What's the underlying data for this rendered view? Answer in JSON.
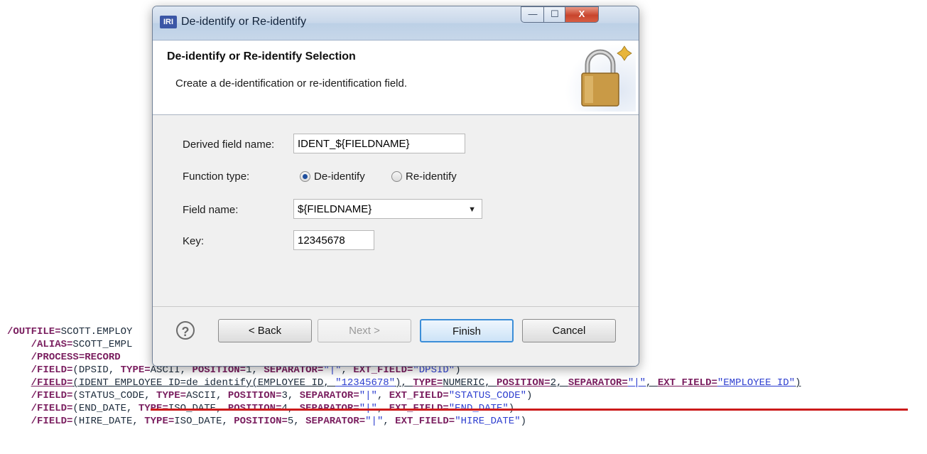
{
  "code_lines": [
    {
      "indent": "",
      "parts": [
        {
          "t": "/OUTFILE=",
          "c": "kw"
        },
        {
          "t": "SCOTT.EMPLOY",
          "c": "sym"
        }
      ]
    },
    {
      "indent": "    ",
      "parts": [
        {
          "t": "/ALIAS=",
          "c": "kw"
        },
        {
          "t": "SCOTT_EMPL",
          "c": "sym"
        }
      ]
    },
    {
      "indent": "    ",
      "parts": [
        {
          "t": "/PROCESS=",
          "c": "kw"
        },
        {
          "t": "RECORD",
          "c": "kw"
        }
      ]
    },
    {
      "indent": "    ",
      "parts": [
        {
          "t": "/FIELD=",
          "c": "kw"
        },
        {
          "t": "(DPSID, ",
          "c": "sym"
        },
        {
          "t": "TYPE=",
          "c": "kw"
        },
        {
          "t": "ASCII, ",
          "c": "sym"
        },
        {
          "t": "POSITION=",
          "c": "kw"
        },
        {
          "t": "1, ",
          "c": "sym"
        },
        {
          "t": "SEPARATOR=",
          "c": "kw"
        },
        {
          "t": "\"|\"",
          "c": "str"
        },
        {
          "t": ", ",
          "c": "sym"
        },
        {
          "t": "EXT_FIELD=",
          "c": "kw"
        },
        {
          "t": "\"DPSID\"",
          "c": "str"
        },
        {
          "t": ")",
          "c": "sym"
        }
      ]
    },
    {
      "indent": "    ",
      "parts": [
        {
          "t": "/FIELD=",
          "c": "kw ul"
        },
        {
          "t": "(IDENT_EMPLOYEE_ID=de_identify(EMPLOYEE_ID, ",
          "c": "sym ul"
        },
        {
          "t": "\"12345678\"",
          "c": "str ul"
        },
        {
          "t": "), ",
          "c": "sym ul"
        },
        {
          "t": "TYPE=",
          "c": "kw ul"
        },
        {
          "t": "NUMERIC, ",
          "c": "sym ul"
        },
        {
          "t": "POSITION=",
          "c": "kw ul"
        },
        {
          "t": "2, ",
          "c": "sym ul"
        },
        {
          "t": "SEPARATOR=",
          "c": "kw ul"
        },
        {
          "t": "\"|\"",
          "c": "str ul"
        },
        {
          "t": ", ",
          "c": "sym ul"
        },
        {
          "t": "EXT_FIELD=",
          "c": "kw ul"
        },
        {
          "t": "\"EMPLOYEE_ID\"",
          "c": "str ul"
        },
        {
          "t": ")",
          "c": "sym ul"
        }
      ]
    },
    {
      "indent": "    ",
      "parts": [
        {
          "t": "/FIELD=",
          "c": "kw"
        },
        {
          "t": "(STATUS_CODE, ",
          "c": "sym"
        },
        {
          "t": "TYPE=",
          "c": "kw"
        },
        {
          "t": "ASCII, ",
          "c": "sym"
        },
        {
          "t": "POSITION=",
          "c": "kw"
        },
        {
          "t": "3, ",
          "c": "sym"
        },
        {
          "t": "SEPARATOR=",
          "c": "kw"
        },
        {
          "t": "\"|\"",
          "c": "str"
        },
        {
          "t": ", ",
          "c": "sym"
        },
        {
          "t": "EXT_FIELD=",
          "c": "kw"
        },
        {
          "t": "\"STATUS_CODE\"",
          "c": "str"
        },
        {
          "t": ")",
          "c": "sym"
        }
      ]
    },
    {
      "indent": "    ",
      "parts": [
        {
          "t": "/FIELD=",
          "c": "kw"
        },
        {
          "t": "(END_DATE, ",
          "c": "sym"
        },
        {
          "t": "TYPE=",
          "c": "kw"
        },
        {
          "t": "ISO_DATE, ",
          "c": "sym"
        },
        {
          "t": "POSITION=",
          "c": "kw"
        },
        {
          "t": "4, ",
          "c": "sym"
        },
        {
          "t": "SEPARATOR=",
          "c": "kw"
        },
        {
          "t": "\"|\"",
          "c": "str"
        },
        {
          "t": ", ",
          "c": "sym"
        },
        {
          "t": "EXT_FIELD=",
          "c": "kw"
        },
        {
          "t": "\"END_DATE\"",
          "c": "str"
        },
        {
          "t": ")",
          "c": "sym"
        }
      ]
    },
    {
      "indent": "    ",
      "parts": [
        {
          "t": "/FIELD=",
          "c": "kw"
        },
        {
          "t": "(HIRE_DATE, ",
          "c": "sym"
        },
        {
          "t": "TYPE=",
          "c": "kw"
        },
        {
          "t": "ISO_DATE, ",
          "c": "sym"
        },
        {
          "t": "POSITION=",
          "c": "kw"
        },
        {
          "t": "5, ",
          "c": "sym"
        },
        {
          "t": "SEPARATOR=",
          "c": "kw"
        },
        {
          "t": "\"|\"",
          "c": "str"
        },
        {
          "t": ", ",
          "c": "sym"
        },
        {
          "t": "EXT_FIELD=",
          "c": "kw"
        },
        {
          "t": "\"HIRE_DATE\"",
          "c": "str"
        },
        {
          "t": ")",
          "c": "sym"
        }
      ]
    }
  ],
  "dialog": {
    "app_icon": "IRI",
    "title": "De-identify or Re-identify",
    "window_buttons": {
      "minimize": "—",
      "maximize": "☐",
      "close": "X"
    },
    "banner": {
      "title": "De-identify or Re-identify Selection",
      "description": "Create a de-identification or re-identification field.",
      "icon": "padlock-icon"
    },
    "form": {
      "derived_field_label": "Derived field name:",
      "derived_field_value": "IDENT_${FIELDNAME}",
      "function_type_label": "Function type:",
      "options": [
        {
          "label": "De-identify",
          "selected": true
        },
        {
          "label": "Re-identify",
          "selected": false
        }
      ],
      "field_name_label": "Field name:",
      "field_name_value": "${FIELDNAME}",
      "key_label": "Key:",
      "key_value": "12345678"
    },
    "footer": {
      "help": "?",
      "back": "< Back",
      "next": "Next >",
      "finish": "Finish",
      "cancel": "Cancel"
    }
  },
  "colors": {
    "highlight_underline": "#cc1b1b",
    "keyword": "#7a1e5f",
    "string": "#2e3fd0",
    "titlebar": "#c9d8ea"
  }
}
